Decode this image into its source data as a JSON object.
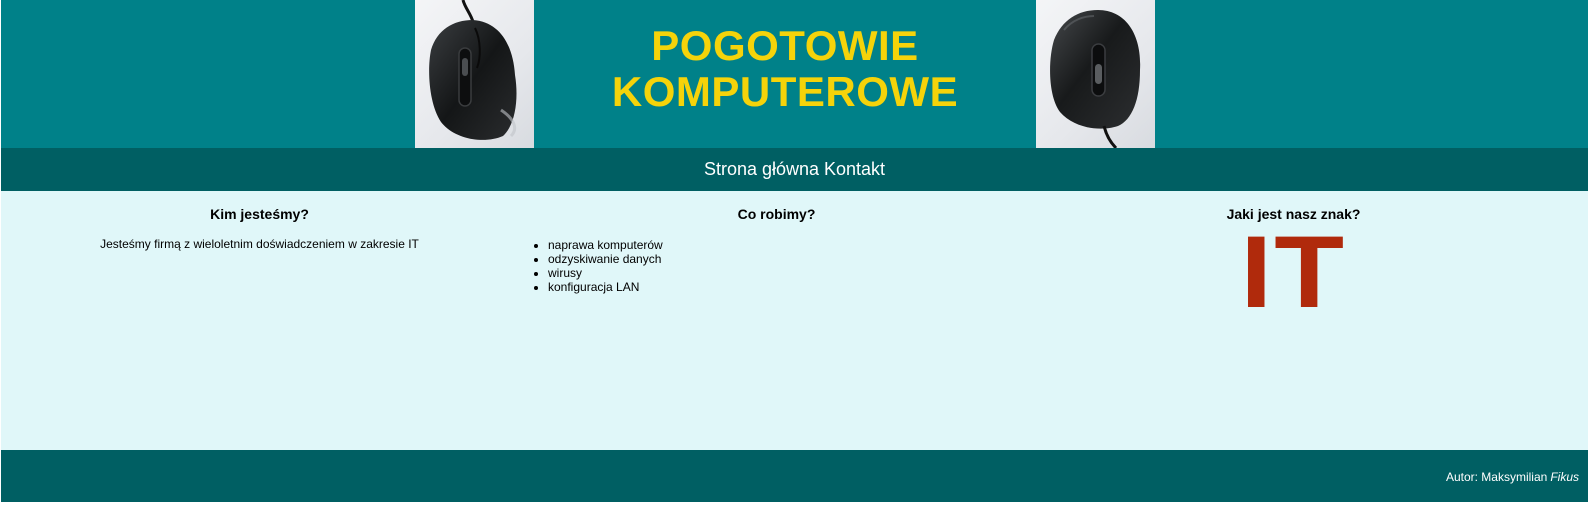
{
  "header": {
    "title_line1": "POGOTOWIE",
    "title_line2": "KOMPUTEROWE",
    "left_image": "computer-mouse-photo",
    "right_image": "computer-mouse-photo",
    "background_color": "#008189",
    "title_color": "#f5d30a"
  },
  "nav": {
    "items": [
      {
        "label": "Strona główna"
      },
      {
        "label": "Kontakt"
      }
    ],
    "background_color": "#005f63"
  },
  "main": {
    "background_color": "#e0f7f9",
    "about": {
      "heading": "Kim jesteśmy?",
      "text": "Jesteśmy firmą z wieloletnim doświadczeniem w zakresie IT"
    },
    "services": {
      "heading": "Co robimy?",
      "items": [
        "naprawa komputerów",
        "odzyskiwanie danych",
        "wirusy",
        "konfiguracja LAN"
      ]
    },
    "sign": {
      "heading": "Jaki jest nasz znak?",
      "logo_text": "IT",
      "logo_color": "#b02a0c"
    }
  },
  "footer": {
    "author_prefix": "Autor: Maksymilian",
    "author_surname": "Fikus"
  }
}
